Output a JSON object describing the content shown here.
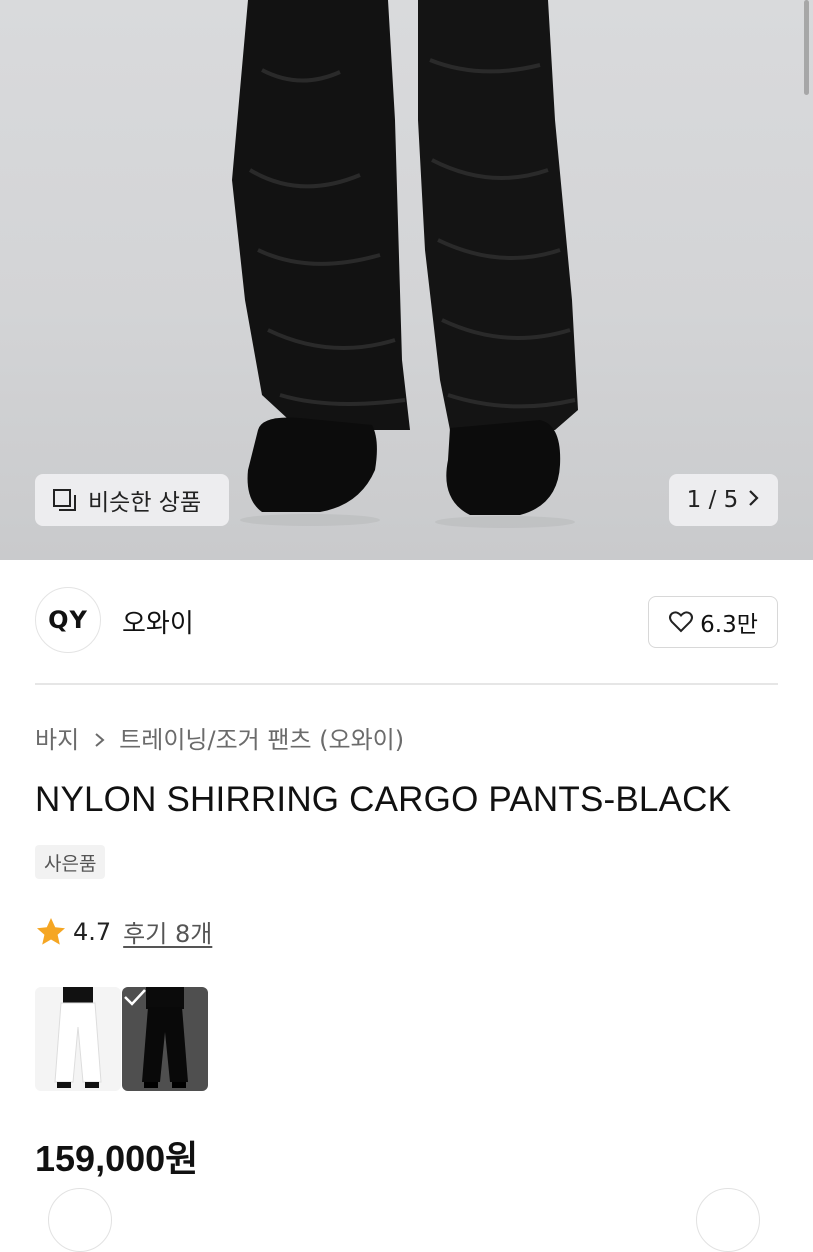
{
  "hero": {
    "similar_label": "비슷한 상품",
    "counter": "1 / 5"
  },
  "brand": {
    "logo_text": "QY",
    "name": "오와이",
    "likes": "6.3만"
  },
  "breadcrumb": {
    "category": "바지",
    "subcategory": "트레이닝/조거 팬츠 (오와이)"
  },
  "product": {
    "title": "NYLON SHIRRING CARGO PANTS-BLACK",
    "tag": "사은품",
    "rating": "4.7",
    "reviews": "후기 8개",
    "price": "159,000원",
    "colors": [
      "white",
      "black"
    ],
    "selected_color": "black"
  },
  "icons": {
    "similar": "similar-products-icon",
    "chevron": "chevron-right-icon",
    "heart": "heart-icon",
    "star": "star-icon",
    "check": "check-icon"
  },
  "colors": {
    "star": "#f5a623",
    "text": "#111111",
    "muted": "#6b6b6b"
  }
}
